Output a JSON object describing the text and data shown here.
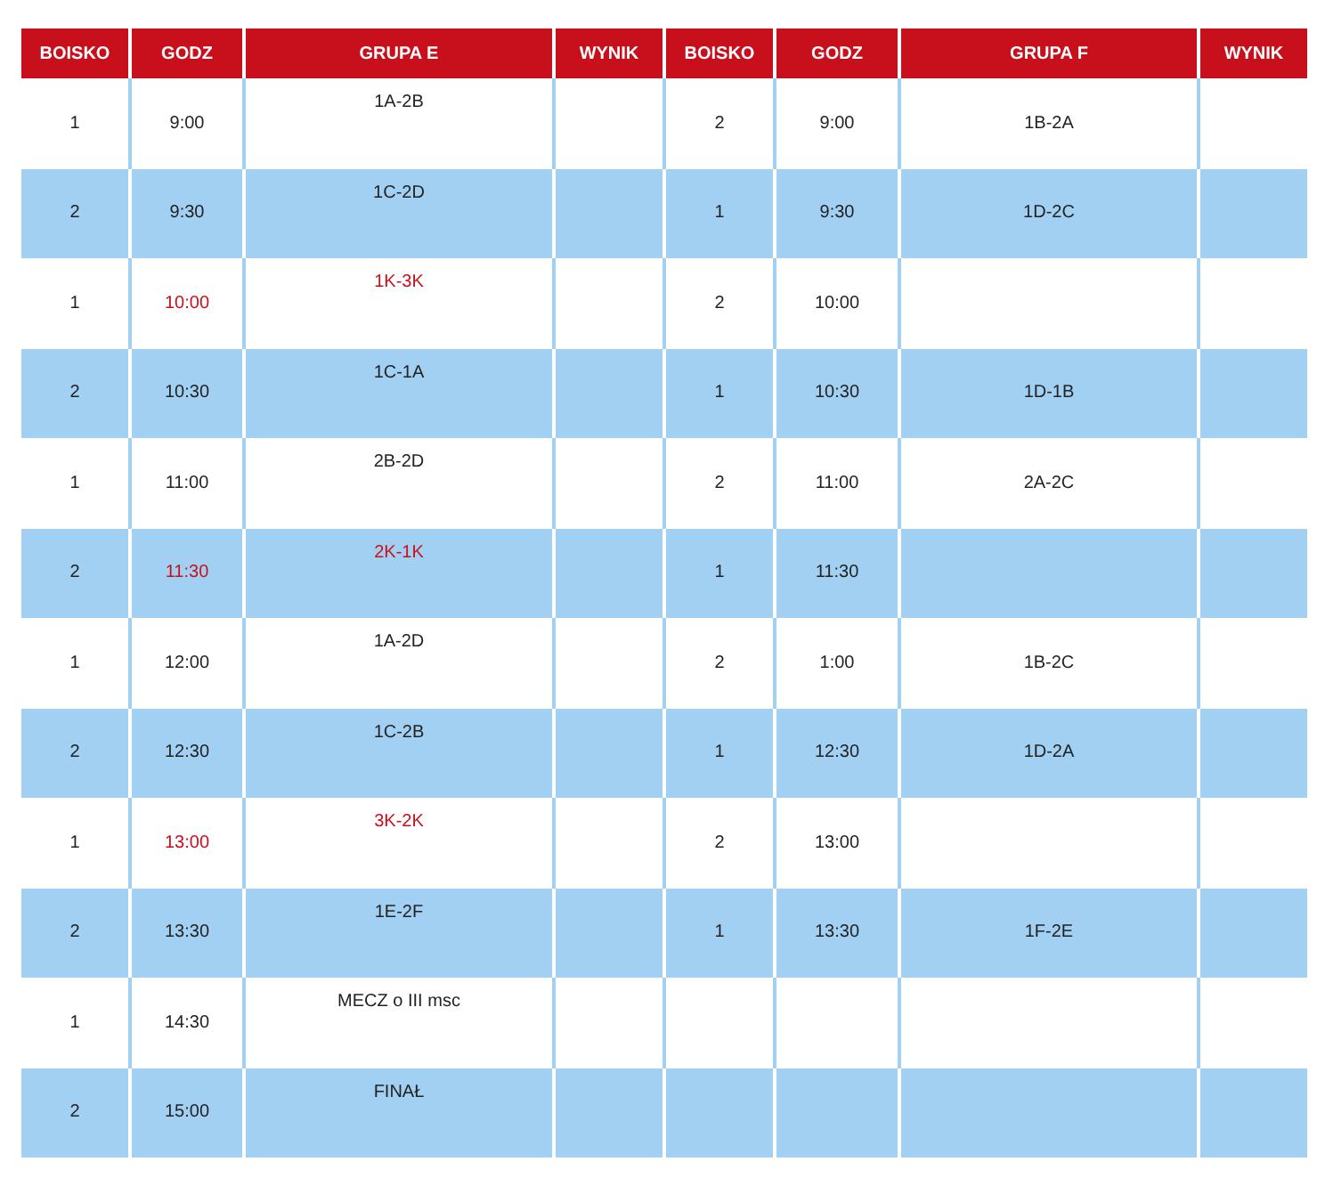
{
  "table": {
    "columns": [
      "BOISKO",
      "GODZ",
      "GRUPA E",
      "WYNIK",
      "BOISKO",
      "GODZ",
      "GRUPA F",
      "WYNIK"
    ],
    "rows": [
      {
        "boisko_e": "1",
        "godz_e": "9:00",
        "grupa_e": "1A-2B",
        "highlighted": false,
        "boisko_f": "2",
        "godz_f": "9:00",
        "grupa_f": "1B-2A"
      },
      {
        "boisko_e": "2",
        "godz_e": "9:30",
        "grupa_e": "1C-2D",
        "highlighted": false,
        "boisko_f": "1",
        "godz_f": "9:30",
        "grupa_f": "1D-2C"
      },
      {
        "boisko_e": "1",
        "godz_e": "10:00",
        "grupa_e": "1K-3K",
        "highlighted": true,
        "boisko_f": "2",
        "godz_f": "10:00"
      },
      {
        "boisko_e": "2",
        "godz_e": "10:30",
        "grupa_e": "1C-1A",
        "highlighted": false,
        "boisko_f": "1",
        "godz_f": "10:30",
        "grupa_f": "1D-1B"
      },
      {
        "boisko_e": "1",
        "godz_e": "11:00",
        "grupa_e": "2B-2D",
        "highlighted": false,
        "boisko_f": "2",
        "godz_f": "11:00",
        "grupa_f": "2A-2C"
      },
      {
        "boisko_e": "2",
        "godz_e": "11:30",
        "grupa_e": "2K-1K",
        "highlighted": true,
        "boisko_f": "1",
        "godz_f": "11:30"
      },
      {
        "boisko_e": "1",
        "godz_e": "12:00",
        "grupa_e": "1A-2D",
        "highlighted": false,
        "boisko_f": "2",
        "godz_f": "1:00",
        "grupa_f": "1B-2C"
      },
      {
        "boisko_e": "2",
        "godz_e": "12:30",
        "grupa_e": "1C-2B",
        "highlighted": false,
        "boisko_f": "1",
        "godz_f": "12:30",
        "grupa_f": "1D-2A"
      },
      {
        "boisko_e": "1",
        "godz_e": "13:00",
        "grupa_e": "3K-2K",
        "highlighted": true,
        "boisko_f": "2",
        "godz_f": "13:00"
      },
      {
        "boisko_e": "2",
        "godz_e": "13:30",
        "grupa_e": "1E-2F",
        "highlighted": false,
        "boisko_f": "1",
        "godz_f": "13:30",
        "grupa_f": "1F-2E"
      },
      {
        "boisko_e": "1",
        "godz_e": "14:30",
        "grupa_e": "MECZ o III msc",
        "highlighted": false
      },
      {
        "boisko_e": "2",
        "godz_e": "15:00",
        "grupa_e": "FINAŁ",
        "highlighted": false
      }
    ]
  }
}
